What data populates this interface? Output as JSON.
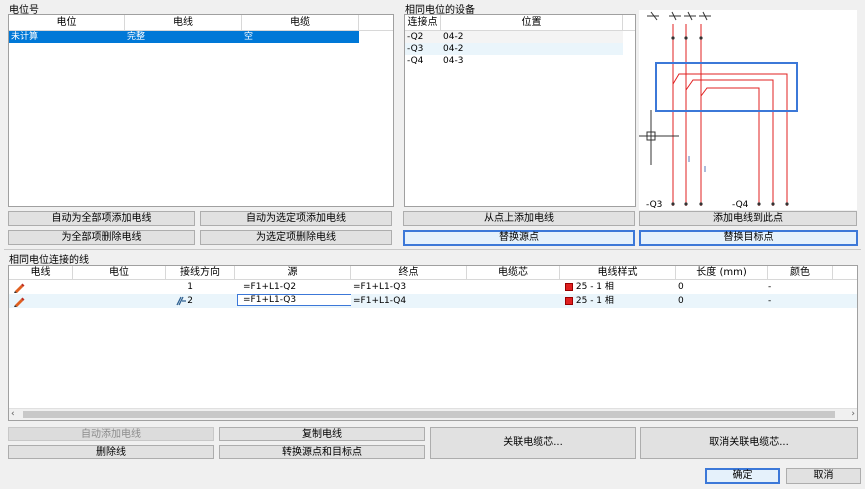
{
  "potential": {
    "group_title": "电位号",
    "columns": [
      "电位",
      "电线",
      "电缆"
    ],
    "rows": [
      {
        "potential": "未计算",
        "wire": "完整",
        "cable": "空"
      }
    ]
  },
  "same_potential_devices": {
    "group_title": "相同电位的设备",
    "columns": [
      "连接点",
      "位置"
    ],
    "rows": [
      {
        "point": "-Q2",
        "location": "04-2"
      },
      {
        "point": "-Q3",
        "location": "04-2"
      },
      {
        "point": "-Q4",
        "location": "04-3"
      }
    ]
  },
  "preview": {
    "label_left": "-Q3",
    "label_right": "-Q4",
    "wire_color": "#e02020",
    "highlight_color": "#3c78d8"
  },
  "top_buttons": {
    "auto_add_all": "自动为全部项添加电线",
    "auto_add_selected": "自动为选定项添加电线",
    "delete_all": "为全部项删除电线",
    "delete_selected": "为选定项删除电线",
    "add_from_point": "从点上添加电线",
    "add_to_point": "添加电线到此点",
    "replace_source": "替换源点",
    "replace_target": "替换目标点"
  },
  "connections": {
    "group_title": "相同电位连接的线",
    "columns": [
      "电线",
      "电位",
      "接线方向",
      "源",
      "终点",
      "电缆芯",
      "电线样式",
      "长度 (mm)",
      "颜色"
    ],
    "rows": [
      {
        "direction": "1",
        "source": "=F1+L1-Q2",
        "target": "=F1+L1-Q3",
        "core": "",
        "style": "25 - 1 相",
        "length": "0",
        "color": "-"
      },
      {
        "direction": "2",
        "source": "=F1+L1-Q3",
        "target": "=F1+L1-Q4",
        "core": "",
        "style": "25 - 1 相",
        "length": "0",
        "color": "-"
      }
    ],
    "style_swatch": "#e02020"
  },
  "bottom_buttons": {
    "auto_add_wire": "自动添加电线",
    "copy_wire": "复制电线",
    "delete_wire": "删除线",
    "swap_points": "转换源点和目标点",
    "link_core": "关联电缆芯...",
    "unlink_core": "取消关联电缆芯..."
  },
  "dialog": {
    "ok": "确定",
    "cancel": "取消"
  }
}
